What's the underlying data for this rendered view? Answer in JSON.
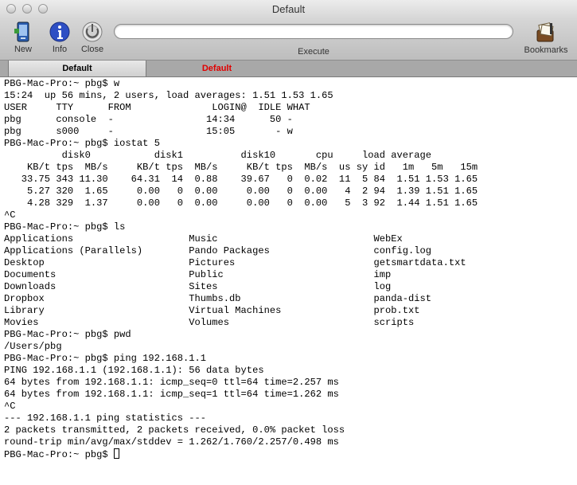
{
  "window": {
    "title": "Default"
  },
  "toolbar": {
    "new_label": "New",
    "info_label": "Info",
    "close_label": "Close",
    "command_value": "",
    "execute_label": "Execute",
    "bookmarks_label": "Bookmarks"
  },
  "tabs": [
    {
      "label": "Default",
      "active": true
    },
    {
      "label": "Default",
      "active": false,
      "color": "#e00000"
    }
  ],
  "terminal": {
    "lines": [
      "PBG-Mac-Pro:~ pbg$ w",
      "15:24  up 56 mins, 2 users, load averages: 1.51 1.53 1.65",
      "USER     TTY      FROM              LOGIN@  IDLE WHAT",
      "pbg      console  -                14:34      50 -",
      "pbg      s000     -                15:05       - w",
      "PBG-Mac-Pro:~ pbg$ iostat 5",
      "          disk0           disk1          disk10       cpu     load average",
      "    KB/t tps  MB/s     KB/t tps  MB/s     KB/t tps  MB/s  us sy id   1m   5m   15m",
      "   33.75 343 11.30    64.31  14  0.88    39.67   0  0.02  11  5 84  1.51 1.53 1.65",
      "    5.27 320  1.65     0.00   0  0.00     0.00   0  0.00   4  2 94  1.39 1.51 1.65",
      "    4.28 329  1.37     0.00   0  0.00     0.00   0  0.00   5  3 92  1.44 1.51 1.65",
      "^C",
      "PBG-Mac-Pro:~ pbg$ ls",
      "Applications                    Music                           WebEx",
      "Applications (Parallels)        Pando Packages                  config.log",
      "Desktop                         Pictures                        getsmartdata.txt",
      "Documents                       Public                          imp",
      "Downloads                       Sites                           log",
      "Dropbox                         Thumbs.db                       panda-dist",
      "Library                         Virtual Machines                prob.txt",
      "Movies                          Volumes                         scripts",
      "PBG-Mac-Pro:~ pbg$ pwd",
      "/Users/pbg",
      "PBG-Mac-Pro:~ pbg$ ping 192.168.1.1",
      "PING 192.168.1.1 (192.168.1.1): 56 data bytes",
      "64 bytes from 192.168.1.1: icmp_seq=0 ttl=64 time=2.257 ms",
      "64 bytes from 192.168.1.1: icmp_seq=1 ttl=64 time=1.262 ms",
      "^C",
      "--- 192.168.1.1 ping statistics ---",
      "2 packets transmitted, 2 packets received, 0.0% packet loss",
      "round-trip min/avg/max/stddev = 1.262/1.760/2.257/0.498 ms"
    ],
    "prompt": "PBG-Mac-Pro:~ pbg$ "
  }
}
